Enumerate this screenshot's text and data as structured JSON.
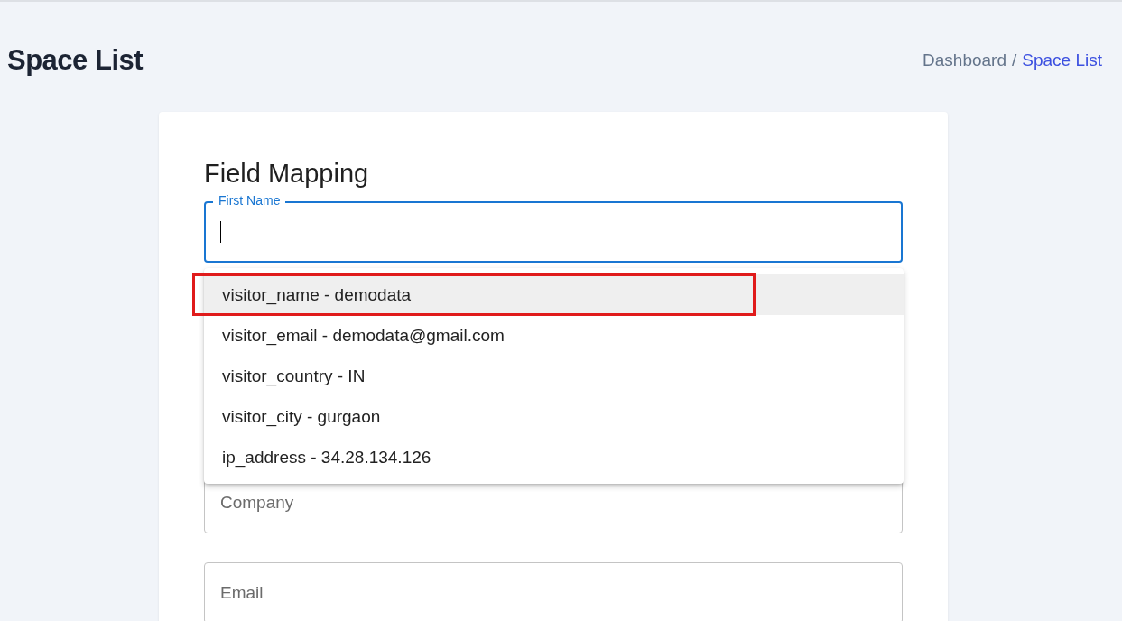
{
  "page": {
    "title": "Space List"
  },
  "breadcrumb_separator": "/",
  "breadcrumb": [
    {
      "label": "Dashboard",
      "selected": false
    },
    {
      "label": "Space List",
      "selected": true
    }
  ],
  "card": {
    "title": "Field Mapping"
  },
  "fields": [
    {
      "label": "First Name",
      "focused": true
    },
    {
      "label": "Company",
      "focused": false
    },
    {
      "label": "Email",
      "focused": false
    }
  ],
  "dropdown": {
    "options": [
      {
        "label": "visitor_name - demodata",
        "selected": true,
        "annotated": true
      },
      {
        "label": "visitor_email - demodata@gmail.com",
        "selected": false,
        "annotated": false
      },
      {
        "label": "visitor_country - IN",
        "selected": false,
        "annotated": false
      },
      {
        "label": "visitor_city - gurgaon",
        "selected": false,
        "annotated": false
      },
      {
        "label": "ip_address - 34.28.134.126",
        "selected": false,
        "annotated": false
      }
    ]
  }
}
